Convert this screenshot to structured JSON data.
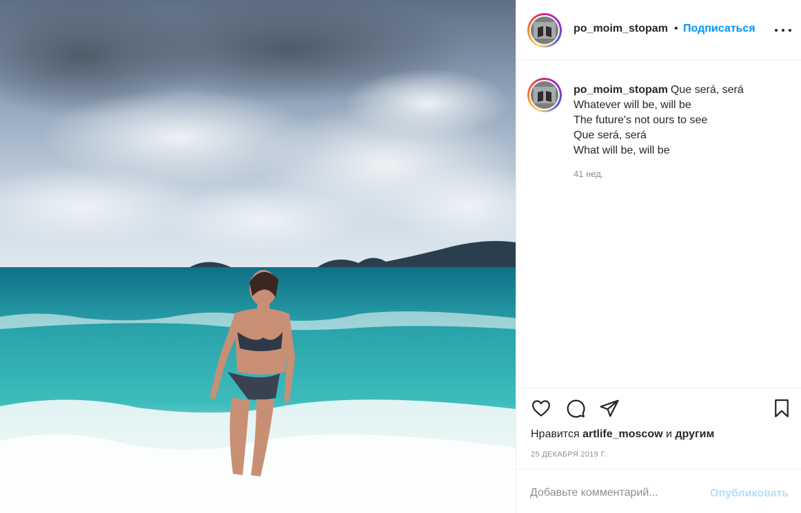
{
  "post": {
    "username": "po_moim_stopam",
    "follow_separator": "•",
    "follow_label": "Подписаться",
    "caption_lines": [
      "Que será, será",
      "Whatever will be, will be",
      "The future's not ours to see",
      "Que será, será",
      "What will be, will be"
    ],
    "time_ago": "41 нед.",
    "likes_prefix": "Нравится",
    "likes_user": "artlife_moscow",
    "likes_and": "и",
    "likes_others": "другим",
    "date": "25 ДЕКАБРЯ 2019 Г."
  },
  "comment": {
    "placeholder": "Добавьте комментарий...",
    "publish_label": "Опубликовать"
  },
  "icons": {
    "like": "heart-icon",
    "comment": "comment-icon",
    "share": "paper-plane-icon",
    "save": "bookmark-icon",
    "more": "more-options-icon"
  },
  "colors": {
    "link_blue": "#0095f6",
    "publish_disabled": "#b2dffc",
    "secondary_text": "#8e8e8e",
    "border": "#efefef"
  }
}
